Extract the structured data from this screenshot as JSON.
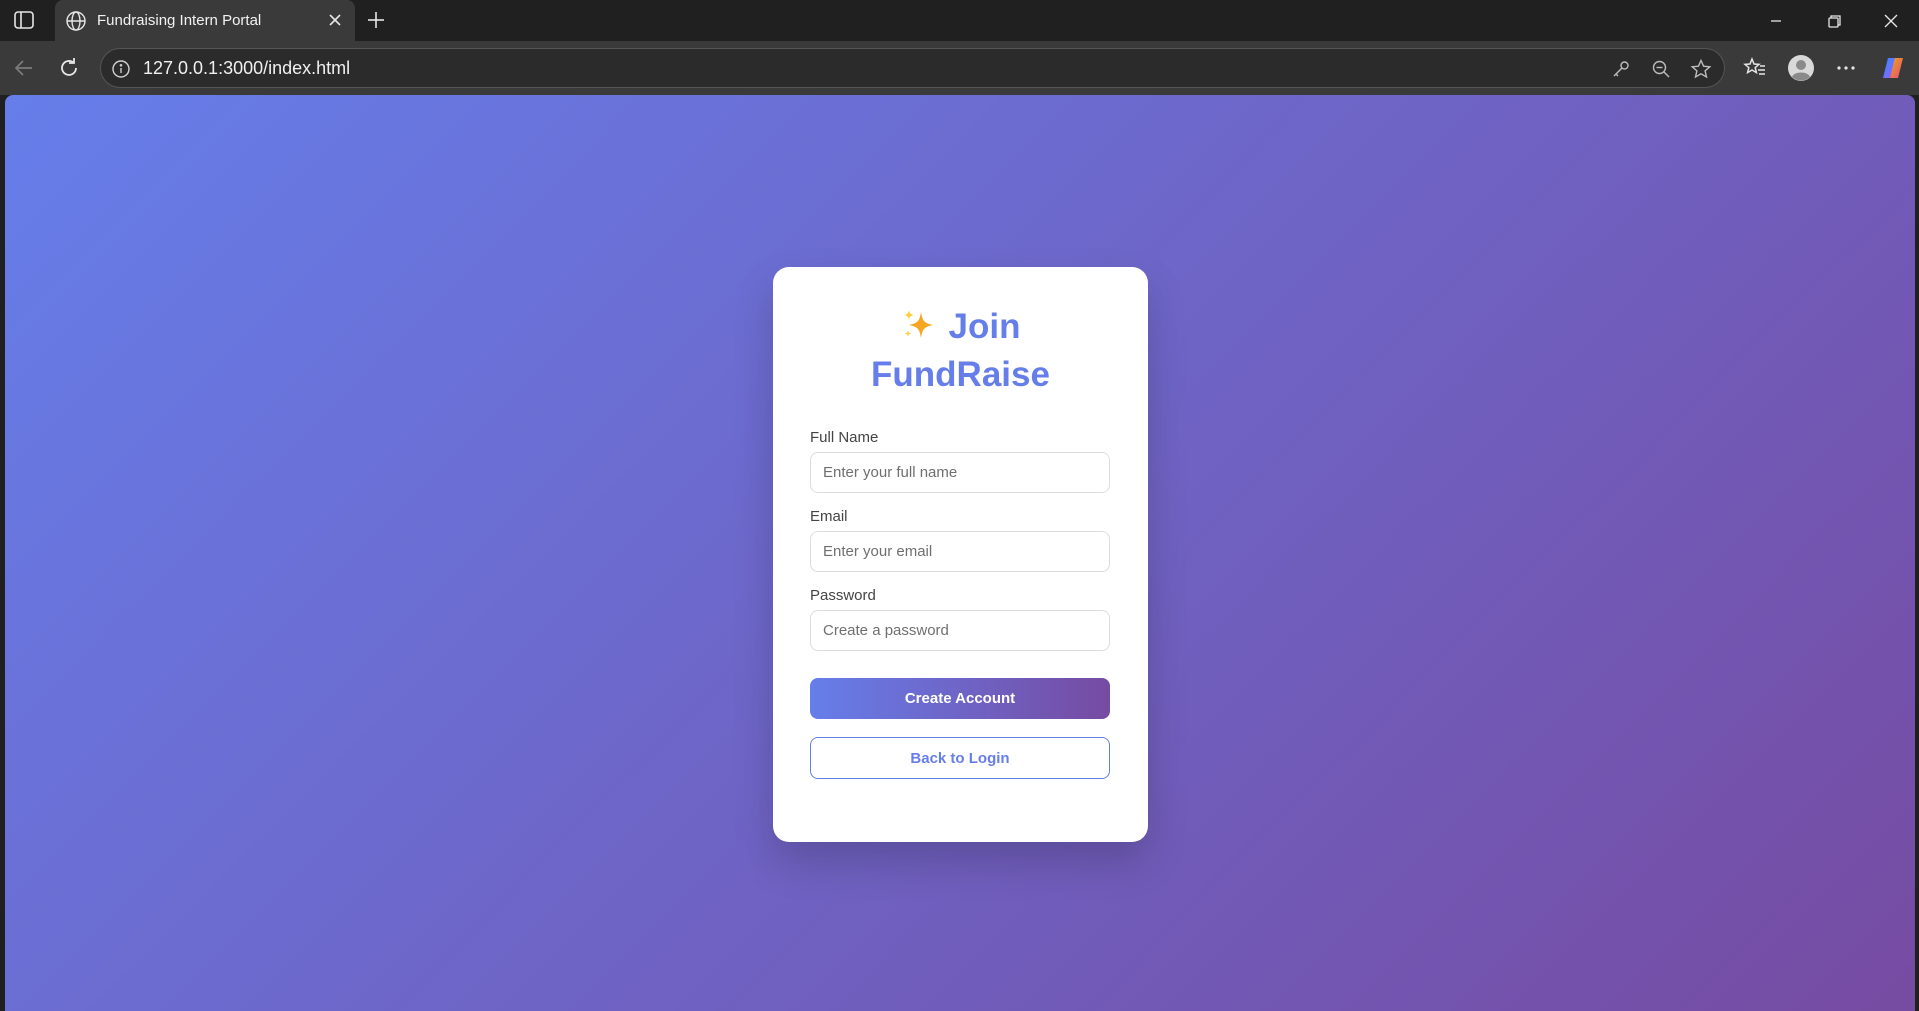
{
  "browser": {
    "tab_title": "Fundraising Intern Portal",
    "url": "127.0.0.1:3000/index.html"
  },
  "signup": {
    "heading_line1": "Join",
    "heading_line2": "FundRaise",
    "sparkle_icon": "sparkles-emoji",
    "full_name_label": "Full Name",
    "full_name_placeholder": "Enter your full name",
    "email_label": "Email",
    "email_placeholder": "Enter your email",
    "password_label": "Password",
    "password_placeholder": "Create a password",
    "create_button": "Create Account",
    "back_button": "Back to Login"
  },
  "colors": {
    "gradient_start": "#667eea",
    "gradient_end": "#764ba2",
    "card_bg": "#ffffff"
  }
}
